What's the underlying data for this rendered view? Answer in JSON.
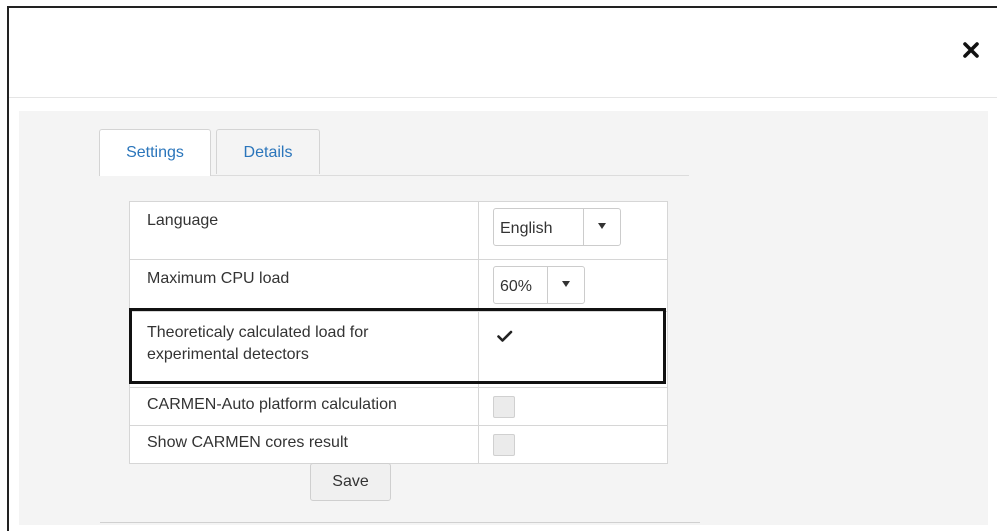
{
  "dialog": {
    "close_icon": "close-icon"
  },
  "tabs": [
    {
      "label": "Settings",
      "active": true
    },
    {
      "label": "Details",
      "active": false
    }
  ],
  "settings": {
    "language": {
      "label": "Language",
      "value": "English"
    },
    "cpu_load": {
      "label": "Maximum CPU load",
      "value": "60%"
    },
    "theoretical_load": {
      "label_line1": "Theoreticaly calculated load for",
      "label_line2": "experimental detectors",
      "checked": true
    },
    "carmen_auto": {
      "label": "CARMEN-Auto platform calculation",
      "checked": false
    },
    "carmen_cores": {
      "label": "Show CARMEN cores result",
      "checked": false
    }
  },
  "actions": {
    "save_label": "Save"
  },
  "colors": {
    "tab_text": "#2a75bb",
    "body_bg": "#f4f4f4",
    "highlight_border": "#111111"
  }
}
